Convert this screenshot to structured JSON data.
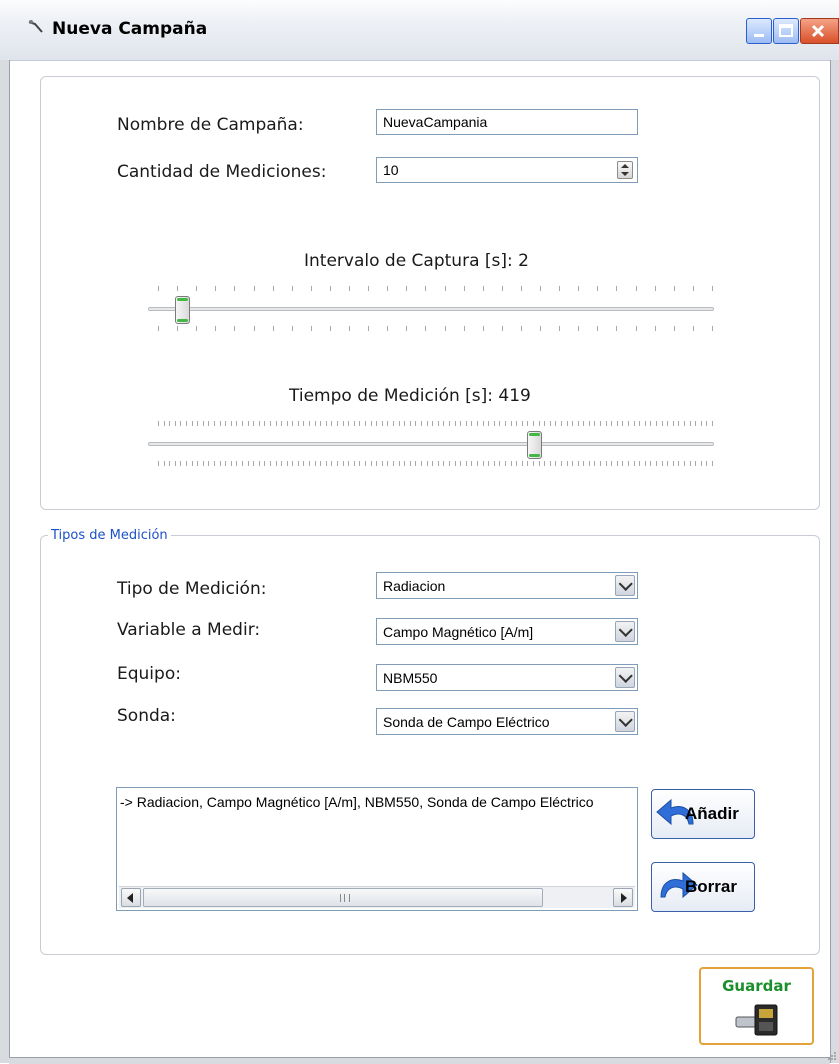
{
  "window": {
    "title": "Nueva Campaña",
    "colors": {
      "title_accent": "#1c51c8",
      "close": "#d9502a",
      "slider_thumb_mark": "#44b844",
      "save_text": "#1c8e2c"
    }
  },
  "campaign": {
    "name_label": "Nombre de Campaña:",
    "name_value": "NuevaCampania",
    "count_label": "Cantidad de Mediciones:",
    "count_value": "10"
  },
  "sliders": {
    "interval": {
      "label": "Intervalo de Captura [s]: 2",
      "value": 2,
      "position_fraction": 0.046
    },
    "measure_time": {
      "label": "Tiempo de Medición [s]: 419",
      "value": 419,
      "position_fraction": 0.685
    }
  },
  "measurement_types": {
    "group_title": "Tipos de Medición",
    "type_label": "Tipo de Medición:",
    "type_value": "Radiacion",
    "variable_label": "Variable a Medir:",
    "variable_value": "Campo Magnético [A/m]",
    "equipment_label": "Equipo:",
    "equipment_value": "NBM550",
    "probe_label": "Sonda:",
    "probe_value": "Sonda de Campo Eléctrico",
    "list_items": [
      "-> Radiacion, Campo Magnético [A/m], NBM550, Sonda de Campo Eléctrico"
    ],
    "scroll_grip": "III",
    "add_label": "Añadir",
    "delete_label": "Borrar"
  },
  "save_label": "Guardar",
  "icons": [
    "app-icon",
    "minimize-icon",
    "maximize-icon",
    "close-icon",
    "spin-icon",
    "chevron-down-icon",
    "scroll-left-icon",
    "scroll-right-icon",
    "undo-arrow-icon",
    "redo-arrow-icon",
    "save-device-icon",
    "resize-grip-icon"
  ]
}
